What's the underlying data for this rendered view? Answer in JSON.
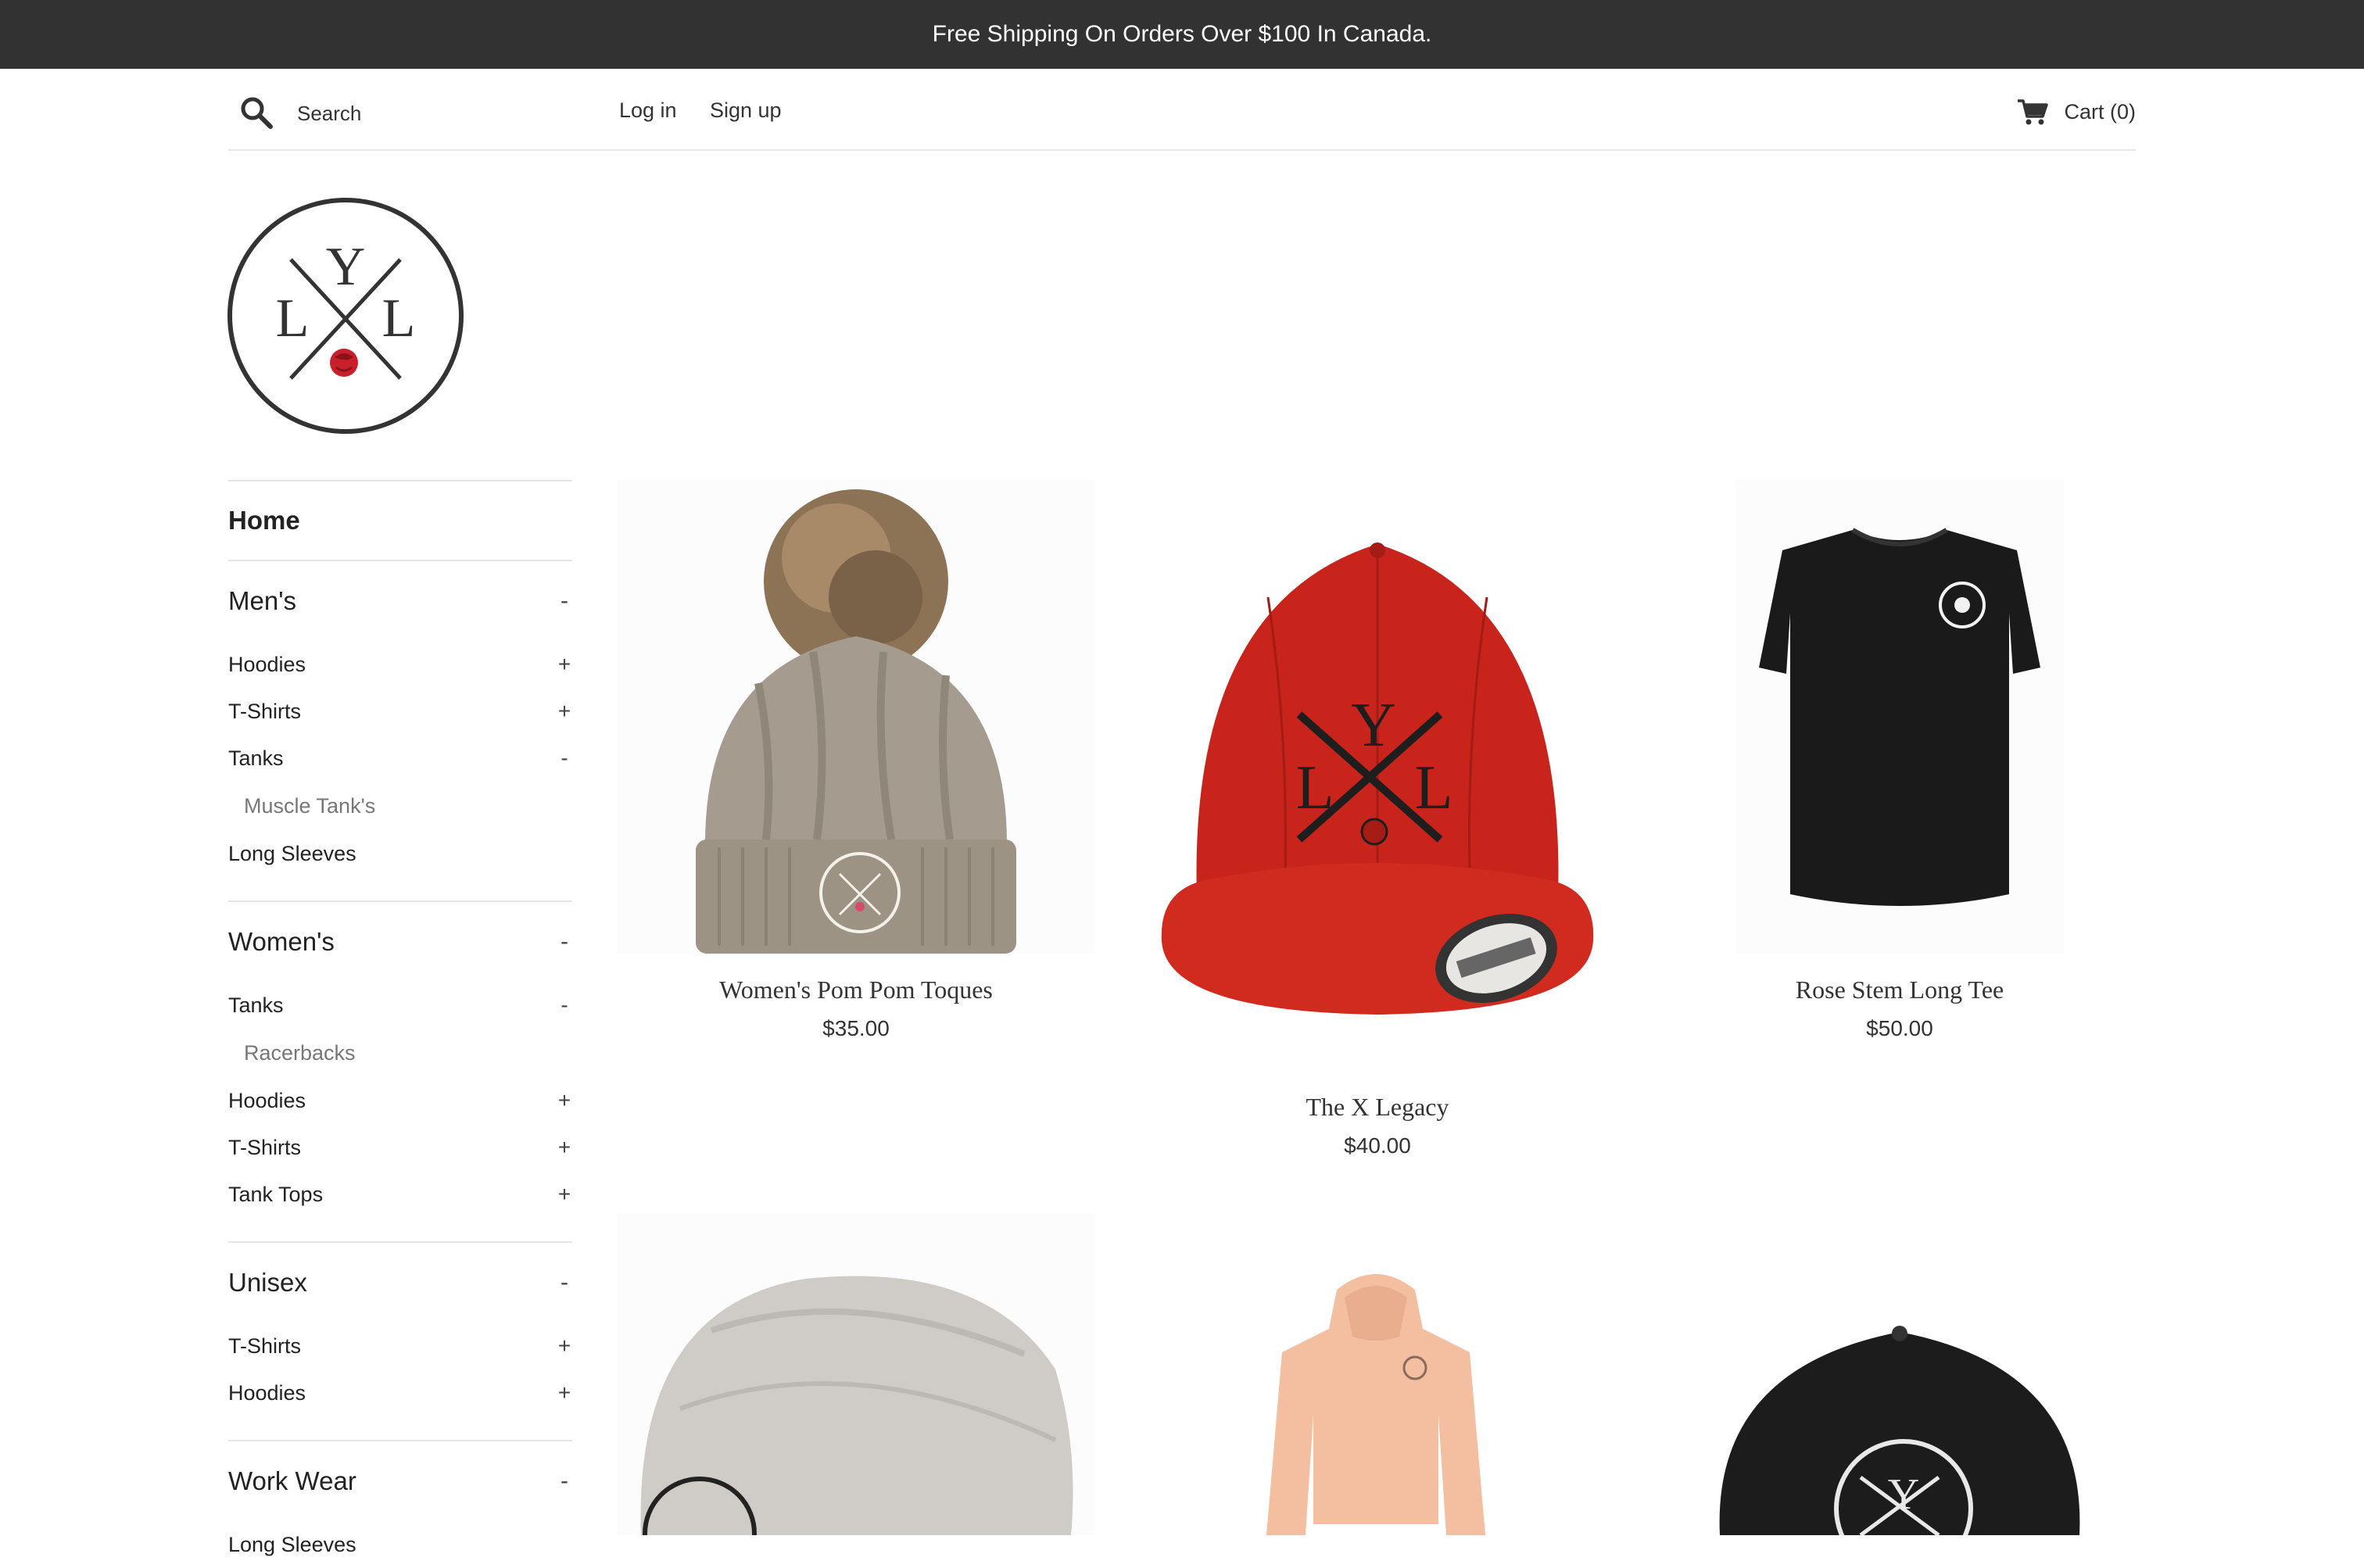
{
  "announcement": "Free Shipping On Orders Over $100 In Canada.",
  "header": {
    "search_placeholder": "Search",
    "login": "Log in",
    "signup": "Sign up",
    "cart": "Cart (0)"
  },
  "logo": {
    "letters": "LYL",
    "accent_color": "#c8202a"
  },
  "sidebar": {
    "home": "Home",
    "mens": {
      "title": "Men's",
      "toggle": "-",
      "items": [
        {
          "label": "Hoodies",
          "toggle": "+"
        },
        {
          "label": "T-Shirts",
          "toggle": "+"
        },
        {
          "label": "Tanks",
          "toggle": "-"
        }
      ],
      "tanks_sub": "Muscle Tank's",
      "long_sleeves": "Long Sleeves"
    },
    "womens": {
      "title": "Women's",
      "toggle": "-",
      "tanks": {
        "label": "Tanks",
        "toggle": "-"
      },
      "tanks_sub": "Racerbacks",
      "items": [
        {
          "label": "Hoodies",
          "toggle": "+"
        },
        {
          "label": "T-Shirts",
          "toggle": "+"
        },
        {
          "label": "Tank Tops",
          "toggle": "+"
        }
      ]
    },
    "unisex": {
      "title": "Unisex",
      "toggle": "-",
      "items": [
        {
          "label": "T-Shirts",
          "toggle": "+"
        },
        {
          "label": "Hoodies",
          "toggle": "+"
        }
      ]
    },
    "workwear": {
      "title": "Work Wear",
      "toggle": "-",
      "first_item": "Long Sleeves"
    }
  },
  "products": [
    {
      "title": "Women's Pom Pom Toques",
      "price": "$35.00"
    },
    {
      "title": "The X Legacy",
      "price": "$40.00"
    },
    {
      "title": "Rose Stem Long Tee",
      "price": "$50.00"
    }
  ],
  "colors": {
    "announcement_bg": "#323232",
    "hat_red": "#c8241b",
    "divider": "#e6e6e6"
  }
}
